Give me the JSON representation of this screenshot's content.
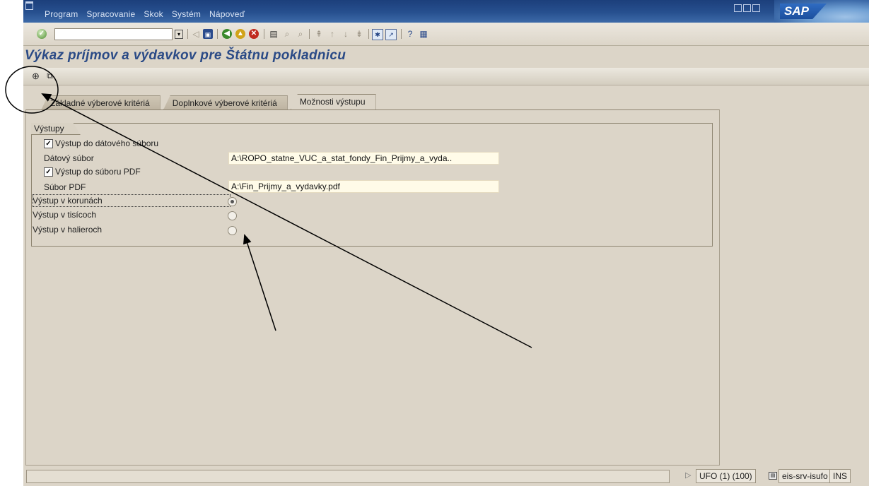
{
  "menu": {
    "items": [
      "Program",
      "Spracovanie",
      "Skok",
      "Systém",
      "Nápoveď"
    ]
  },
  "brand": {
    "logo_text": "SAP"
  },
  "page": {
    "title": "Výkaz príjmov a výdavkov pre Štátnu pokladnicu"
  },
  "tabs": [
    {
      "label": "Základné výberové kritériá",
      "active": false
    },
    {
      "label": "Doplnkové výberové kritériá",
      "active": false
    },
    {
      "label": "Možnosti výstupu",
      "active": true
    }
  ],
  "group": {
    "title": "Výstupy",
    "checkbox_data_file": {
      "label": "Výstup do dátového súboru",
      "checked": true
    },
    "data_file": {
      "label": "Dátový súbor",
      "value": "A:\\ROPO_statne_VUC_a_stat_fondy_Fin_Prijmy_a_vyda.."
    },
    "checkbox_pdf": {
      "label": "Výstup do súboru PDF",
      "checked": true
    },
    "pdf_file": {
      "label": "Súbor PDF",
      "value": "A:\\Fin_Prijmy_a_vydavky.pdf"
    },
    "radios": [
      {
        "label": "Výstup v korunách",
        "selected": true
      },
      {
        "label": "Výstup v tisícoch",
        "selected": false
      },
      {
        "label": "Výstup v halieroch",
        "selected": false
      }
    ]
  },
  "status": {
    "system": "UFO (1) (100)",
    "server": "eis-srv-isufo",
    "mode": "INS"
  }
}
